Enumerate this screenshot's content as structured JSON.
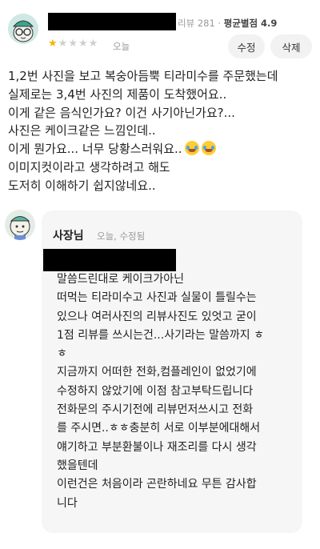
{
  "review": {
    "review_count_label": "리뷰 281",
    "separator": "·",
    "avg_label": "평균별점 4.9",
    "rating": 1,
    "rating_max": 5,
    "date": "오늘",
    "edit_label": "수정",
    "delete_label": "삭제",
    "lines": [
      "1,2번 사진을 보고 복숭아듬뿍 티라미수를 주문했는데",
      "실제로는 3,4번 사진의 제품이 도착했어요..",
      "이게 같은 음식인가요? 이건 사기아닌가요?...",
      "사진은 케이크같은 느낌인데..",
      "이게 뭔가요... 너무 당황스러워요..",
      "이미지컷이라고 생각하려고 해도",
      "도저히 이해하기 쉽지않네요.."
    ]
  },
  "reply": {
    "owner_name": "사장님",
    "meta": "오늘, 수정됨",
    "lines": [
      "말씀드린대로 케이크가아닌",
      "떠먹는 티라미수고 사진과 실물이 틀릴수는",
      "있으나 여러사진의 리뷰사진도 있엇고 굳이",
      "1점 리뷰를 쓰시는건...사기라는 말씀까지 ㅎ",
      "ㅎ",
      "지금까지 어떠한 전화,컴플레인이 없었기에",
      "수정하지 않았기에 이점 참고부탁드립니다",
      " 전화문의 주시기전에 리뷰먼저쓰시고 전화",
      "를 주시면..ㅎㅎ충분히 서로 이부분에대해서",
      "얘기하고 부분환불이나 재조리를 다시 생각",
      "했을텐데",
      "이런건은 처음이라 곤란하네요 무튼 감사합",
      "니다"
    ]
  },
  "colors": {
    "star_active": "#f5b301",
    "star_inactive": "#cfcfcf",
    "reply_bg": "#f6f6f6"
  }
}
